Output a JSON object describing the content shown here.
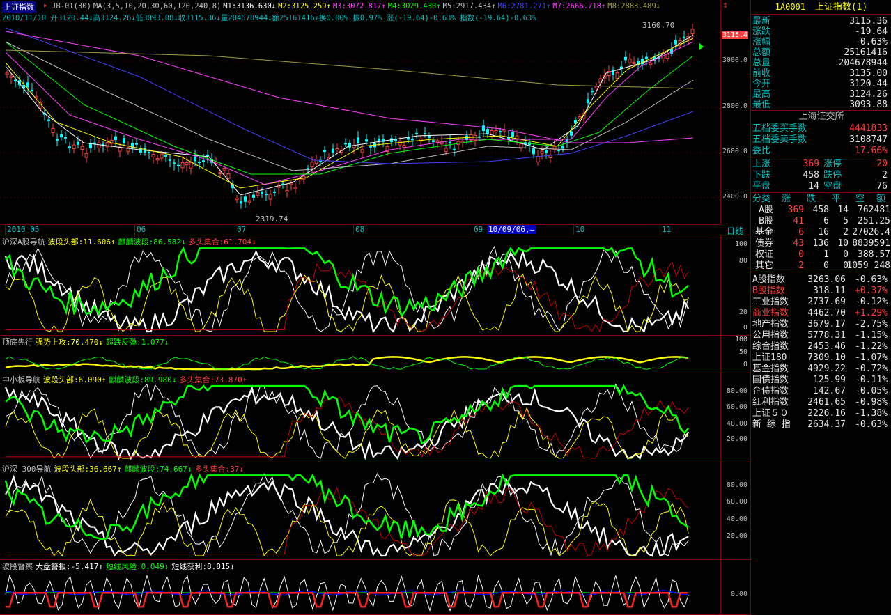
{
  "main": {
    "title": "上证指数",
    "indicator_bar": [
      {
        "text": "JB-01(30)",
        "color": "#c0c0c0"
      },
      {
        "text": "MA(3,5,10,20,30,60,120,240,8)",
        "color": "#c0c0c0"
      },
      {
        "text": "M1:3136.630↓",
        "color": "#ffffff"
      },
      {
        "text": "M2:3125.259↑",
        "color": "#ffff00"
      },
      {
        "text": "M3:3072.817↑",
        "color": "#ff40ff"
      },
      {
        "text": "M4:3029.430↑",
        "color": "#00ff00"
      },
      {
        "text": "M5:2917.434↑",
        "color": "#c0c0c0"
      },
      {
        "text": "M6:2781.271↑",
        "color": "#4040ff"
      },
      {
        "text": "M7:2666.718↑",
        "color": "#ff40ff"
      },
      {
        "text": "M8:2883.489↓",
        "color": "#a0a040"
      }
    ],
    "ohlc_bar": "2010/11/10 开3120.44↓高3124.26↓低3093.88↓收3115.36↓量204678944↓额25161416↑换0.00% 振0.97% 涨(-19.64)-0.63% 指数(-19.64)-0.63%",
    "high_label": "3160.70",
    "low_label": "2319.74",
    "price_tag": "3115.4",
    "y_ticks": [
      "3000.0",
      "2800.0",
      "2600.0",
      "2400.0"
    ],
    "months": [
      "2010 05",
      "06",
      "07",
      "08",
      "09",
      "10",
      "11"
    ],
    "cursor_date": "10/09/06,—",
    "period_label": "日线"
  },
  "panels": [
    {
      "header": [
        {
          "t": "沪深A股导航",
          "c": "#c0c0c0"
        },
        {
          "t": "波段头部:11.606↑",
          "c": "#ffff00"
        },
        {
          "t": "麒麟波段:86.582↓",
          "c": "#00ff00"
        },
        {
          "t": "多头集合:61.704↓",
          "c": "#ff4040"
        }
      ],
      "ticks": [
        "100",
        "80",
        "20",
        "0"
      ]
    },
    {
      "header": [
        {
          "t": "顶底先行",
          "c": "#c0c0c0"
        },
        {
          "t": "强势上攻:70.470↓",
          "c": "#ffff00"
        },
        {
          "t": "超跌反弹:1.077↓",
          "c": "#00ff00"
        }
      ],
      "ticks": [
        "100",
        "50",
        "0"
      ]
    },
    {
      "header": [
        {
          "t": "中小板导航",
          "c": "#c0c0c0"
        },
        {
          "t": "波段头部:6.090↑",
          "c": "#ffff00"
        },
        {
          "t": "麒麟波段:89.980↓",
          "c": "#00ff00"
        },
        {
          "t": "多头集合:73.870↑",
          "c": "#ff4040"
        }
      ],
      "ticks": [
        "80.00",
        "60.00",
        "40.00",
        "20.00"
      ]
    },
    {
      "header": [
        {
          "t": "沪深 300导航",
          "c": "#c0c0c0"
        },
        {
          "t": "波段头部:36.667↑",
          "c": "#ffff00"
        },
        {
          "t": "麒麟波段:74.667↓",
          "c": "#00ff00"
        },
        {
          "t": "多头集合:37↓",
          "c": "#ff4040"
        }
      ],
      "ticks": [
        "80.00",
        "60.00",
        "40.00",
        "20.00"
      ]
    },
    {
      "header": [
        {
          "t": "波段督察",
          "c": "#c0c0c0"
        },
        {
          "t": "大盘警报:-5.417↑",
          "c": "#ffffff"
        },
        {
          "t": "短线风险:0.049↓",
          "c": "#00ff00"
        },
        {
          "t": "短线获利:8.815↓",
          "c": "#ffffff"
        }
      ],
      "ticks": [
        "0.00"
      ]
    }
  ],
  "quote": {
    "code": "1A0001",
    "name": "上证指数(1)",
    "rows": [
      {
        "label": "最新",
        "value": "3115.36",
        "color": "#e8e8e8"
      },
      {
        "label": "涨跌",
        "value": "-19.64",
        "color": "#e8e8e8"
      },
      {
        "label": "涨幅",
        "value": "-0.63%",
        "color": "#e8e8e8"
      },
      {
        "label": "总额",
        "value": "25161416",
        "color": "#e8e8e8"
      },
      {
        "label": "总量",
        "value": "204678944",
        "color": "#e8e8e8"
      },
      {
        "label": "前收",
        "value": "3135.00",
        "color": "#e8e8e8"
      },
      {
        "label": "今开",
        "value": "3120.44",
        "color": "#e8e8e8"
      },
      {
        "label": "最高",
        "value": "3124.26",
        "color": "#e8e8e8"
      },
      {
        "label": "最低",
        "value": "3093.88",
        "color": "#e8e8e8"
      }
    ],
    "exchange": "上海证交所",
    "orders": [
      {
        "label": "五档委买手数",
        "value": "4441833",
        "color": "#ff4040"
      },
      {
        "label": "五档委卖手数",
        "value": "3108747",
        "color": "#e8e8e8"
      },
      {
        "label": "委比",
        "value": "17.66%",
        "color": "#ff4040"
      }
    ],
    "breadth": [
      {
        "l1": "上涨",
        "v1": "369",
        "c1": "#ff4040",
        "l2": "涨停",
        "v2": "20",
        "c2": "#ff4040"
      },
      {
        "l1": "下跌",
        "v1": "458",
        "c1": "#e8e8e8",
        "l2": "跌停",
        "v2": "2",
        "c2": "#e8e8e8"
      },
      {
        "l1": "平盘",
        "v1": "14",
        "c1": "#e8e8e8",
        "l2": "空盘",
        "v2": "76",
        "c2": "#e8e8e8"
      }
    ],
    "class_header": [
      "分类",
      "涨",
      "跌",
      "平",
      "空",
      "额"
    ],
    "classes": [
      {
        "name": "A股",
        "up": "369",
        "down": "458",
        "flat": "14",
        "amt": "762481"
      },
      {
        "name": "B股",
        "up": "41",
        "down": "6",
        "flat": "5",
        "amt": "251.25"
      },
      {
        "name": "基金",
        "up": "6",
        "down": "16",
        "flat": "2",
        "amt": "27026.4"
      },
      {
        "name": "债券",
        "up": "43",
        "down": "136",
        "flat": "10",
        "amt": "8839591"
      },
      {
        "name": "权证",
        "up": "0",
        "down": "1",
        "flat": "0",
        "amt": "388.57"
      },
      {
        "name": "其它",
        "up": "2",
        "down": "0",
        "flat": "0",
        "amt": "1059 248"
      }
    ],
    "indices": [
      {
        "name": "A股指数",
        "value": "3263.06",
        "chg": "-0.63%",
        "nc": "#e8e8e8"
      },
      {
        "name": "B股指数",
        "value": "318.11",
        "chg": "+0.37%",
        "nc": "#ff4040"
      },
      {
        "name": "工业指数",
        "value": "2737.69",
        "chg": "-0.12%",
        "nc": "#e8e8e8"
      },
      {
        "name": "商业指数",
        "value": "4462.70",
        "chg": "+1.29%",
        "nc": "#ff4040"
      },
      {
        "name": "地产指数",
        "value": "3679.17",
        "chg": "-2.75%",
        "nc": "#e8e8e8"
      },
      {
        "name": "公用指数",
        "value": "5778.31",
        "chg": "-1.15%",
        "nc": "#e8e8e8"
      },
      {
        "name": "综合指数",
        "value": "2453.46",
        "chg": "-1.22%",
        "nc": "#e8e8e8"
      },
      {
        "name": "上证180",
        "value": "7309.10",
        "chg": "-1.07%",
        "nc": "#e8e8e8"
      },
      {
        "name": "基金指数",
        "value": "4929.22",
        "chg": "-0.72%",
        "nc": "#e8e8e8"
      },
      {
        "name": "国债指数",
        "value": "125.99",
        "chg": "-0.11%",
        "nc": "#e8e8e8"
      },
      {
        "name": "企债指数",
        "value": "142.67",
        "chg": "-0.05%",
        "nc": "#e8e8e8"
      },
      {
        "name": "红利指数",
        "value": "2461.65",
        "chg": "-0.98%",
        "nc": "#e8e8e8"
      },
      {
        "name": "上证５０",
        "value": "2226.16",
        "chg": "-1.38%",
        "nc": "#e8e8e8"
      },
      {
        "name": "新 综 指",
        "value": "2634.37",
        "chg": "-0.63%",
        "nc": "#e8e8e8"
      }
    ]
  }
}
